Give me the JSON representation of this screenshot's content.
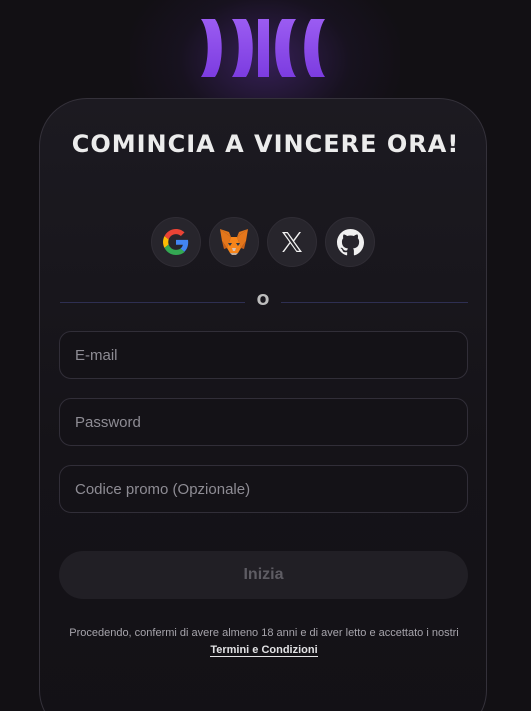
{
  "header": {
    "logo": "brand-logo"
  },
  "signup": {
    "title": "COMINCIA A VINCERE ORA!",
    "social": [
      {
        "name": "Google",
        "icon": "google-icon"
      },
      {
        "name": "MetaMask",
        "icon": "metamask-icon"
      },
      {
        "name": "X",
        "icon": "x-icon"
      },
      {
        "name": "GitHub",
        "icon": "github-icon"
      }
    ],
    "divider_text": "O",
    "email_placeholder": "E-mail",
    "password_placeholder": "Password",
    "promo_placeholder": "Codice promo (Opzionale)",
    "submit_label": "Inizia",
    "legal_text": "Procedendo, confermi di avere almeno 18 anni e di aver letto e accettato i nostri",
    "legal_link": "Termini e Condizioni"
  },
  "colors": {
    "background": "#121014",
    "accent": "#8b4be8",
    "card": "#1a181e"
  }
}
